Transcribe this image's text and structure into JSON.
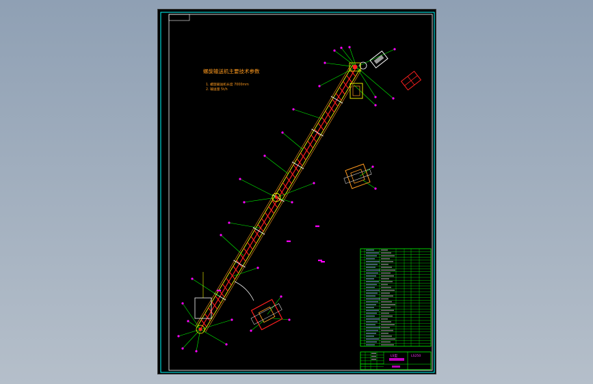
{
  "drawing": {
    "notes_title": "螺旋输送机主要技术参数",
    "notes": [
      "1. 螺旋输送机长度  7000mm",
      "2. 输送量  5t/h"
    ]
  },
  "title_block": {
    "title_text": "LS型",
    "code_text": "LS250"
  },
  "colors": {
    "sheet": "#000000",
    "frame": "#00ffff",
    "leader": "#00ff00",
    "part": "#ff2020",
    "label": "#ff00ff",
    "dim": "#ffff00",
    "text": "#ff9a1e"
  }
}
